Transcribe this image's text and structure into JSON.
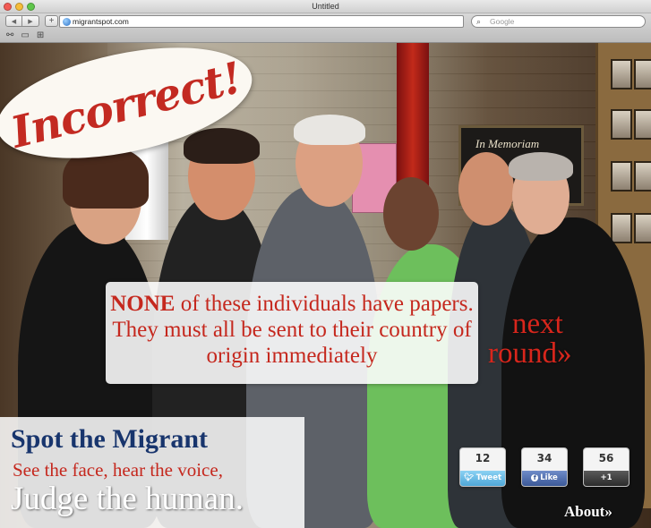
{
  "window": {
    "title": "Untitled"
  },
  "toolbar": {
    "back_glyph": "◀",
    "forward_glyph": "▶",
    "add_glyph": "+",
    "url": "migrantspot.com",
    "search_placeholder": "Google",
    "search_glyph": "⌕",
    "bookmark_glyphs": [
      "⚯",
      "▭",
      "⊞"
    ]
  },
  "result": {
    "label": "Incorrect!",
    "message_strong": "NONE",
    "message_rest": "of these individuals have papers. They must all be sent to their country of origin immediately"
  },
  "memoriam_sign": "In Memoriam",
  "next": {
    "line1": "next",
    "line2": "round»"
  },
  "brand": {
    "title": "Spot the Migrant",
    "subtitle": "See the face, hear the voice,",
    "tagline": "Judge the human."
  },
  "share": {
    "tweet": {
      "count": "12",
      "label": "Tweet"
    },
    "like": {
      "count": "34",
      "label": "Like"
    },
    "plusone": {
      "count": "56",
      "label": "+1"
    }
  },
  "about": "About»",
  "colors": {
    "accent_red": "#c5281e",
    "brand_blue": "#18356d",
    "twitter": "#4fa8d8",
    "facebook": "#3b5998"
  }
}
